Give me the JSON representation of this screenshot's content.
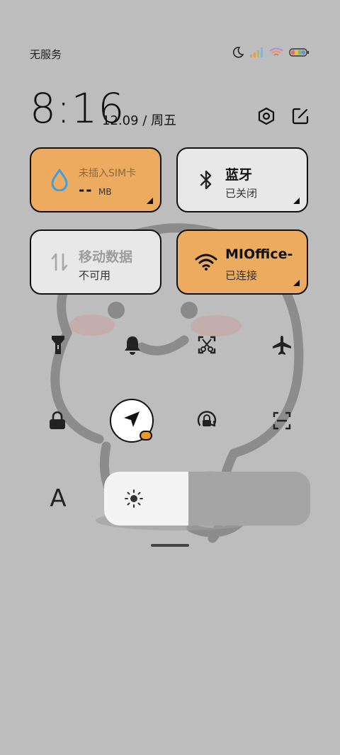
{
  "status_bar": {
    "carrier": "无服务",
    "icons": [
      "moon-icon",
      "signal-icon",
      "wifi-icon",
      "battery-icon"
    ]
  },
  "header": {
    "time": "8:16",
    "date": "12.09 / 周五",
    "icons": [
      "settings-icon",
      "edit-icon"
    ]
  },
  "tiles": {
    "sim": {
      "label": "未插入SIM卡",
      "value": "--",
      "unit": "MB",
      "state": "on"
    },
    "bluetooth": {
      "title": "蓝牙",
      "status": "已关闭",
      "state": "off"
    },
    "mobile_data": {
      "title": "移动数据",
      "status": "不可用",
      "state": "disabled"
    },
    "wifi": {
      "title": "MIOffice-",
      "status": "已连接",
      "state": "on"
    }
  },
  "toggles_row1": [
    "flashlight-icon",
    "bell-icon",
    "screenshot-icon",
    "airplane-icon"
  ],
  "toggles_row2": [
    "lock-icon",
    "location-icon",
    "rotation-lock-icon",
    "scan-icon"
  ],
  "brightness": {
    "level": 0.41,
    "font_label": "A"
  },
  "colors": {
    "background": "#bdbdbd",
    "accent_orange": "#ecab5f",
    "tile_light": "#e8e8e8",
    "water_blue": "#3d9ee0"
  }
}
